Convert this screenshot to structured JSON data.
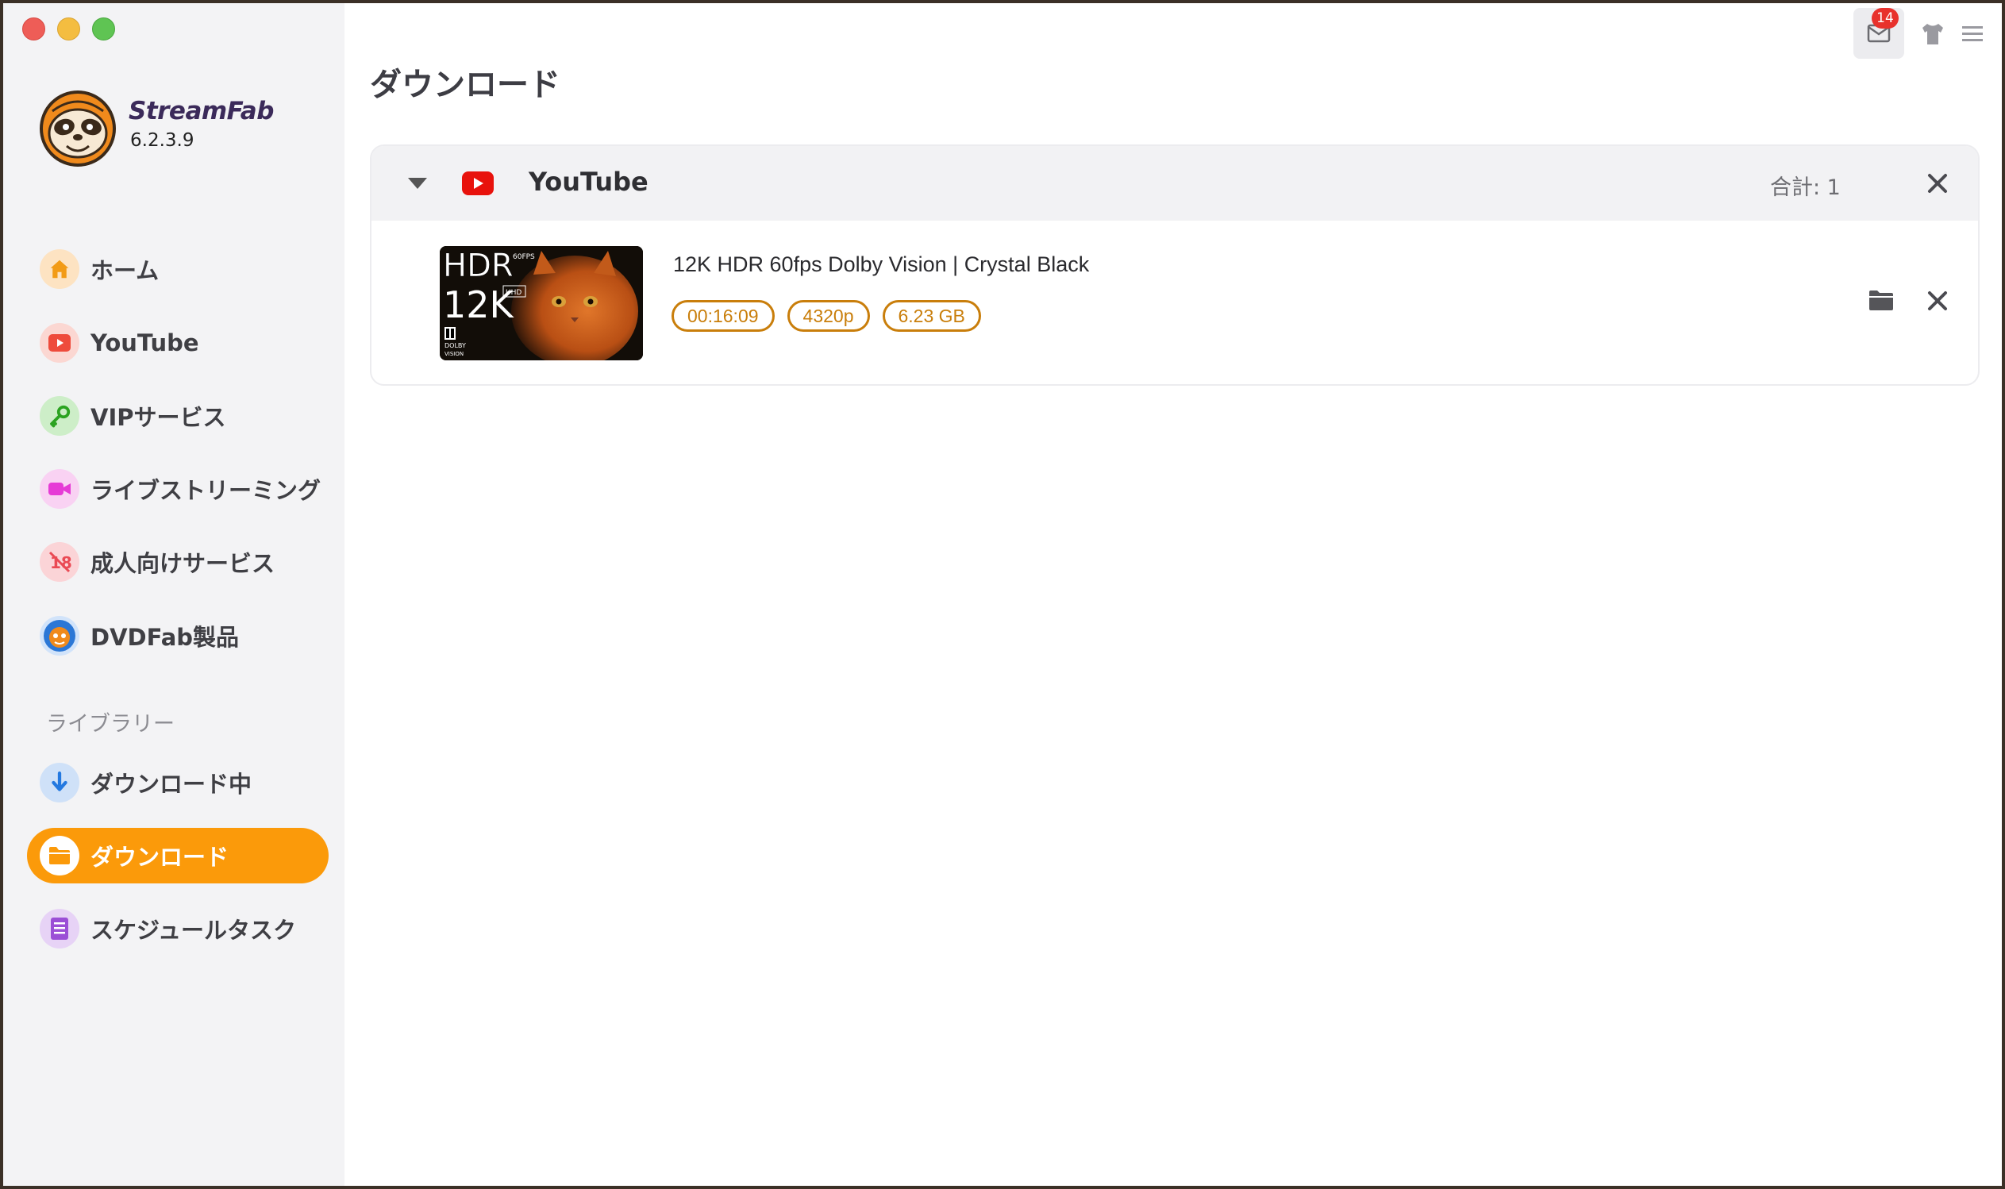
{
  "app": {
    "name": "StreamFab",
    "version": "6.2.3.9"
  },
  "sidebar": {
    "items": [
      {
        "label": "ホーム",
        "icon": "home-icon",
        "color": "#f29b16",
        "bg": "#fde3c2"
      },
      {
        "label": "YouTube",
        "icon": "youtube-icon",
        "color": "#ee4b3c",
        "bg": "#fbd7d2"
      },
      {
        "label": "VIPサービス",
        "icon": "key-icon",
        "color": "#2ba321",
        "bg": "#cdeec8"
      },
      {
        "label": "ライブストリーミング",
        "icon": "video-camera-icon",
        "color": "#e63bd6",
        "bg": "#f9d2f3"
      },
      {
        "label": "成人向けサービス",
        "icon": "adult-18-icon",
        "color": "#ea4a54",
        "bg": "#fbd4d7"
      },
      {
        "label": "DVDFab製品",
        "icon": "dvdfab-icon",
        "color": "#2b77d6",
        "bg": "#d1e3fa"
      }
    ],
    "library_label": "ライブラリー",
    "library_items": [
      {
        "label": "ダウンロード中",
        "icon": "download-arrow-icon",
        "color": "#2479e0",
        "bg": "#cfe1f8"
      },
      {
        "label": "ダウンロード",
        "icon": "folder-icon",
        "color": "#fb9a0a",
        "bg": "#ffffff",
        "active": true
      },
      {
        "label": "スケジュールタスク",
        "icon": "schedule-list-icon",
        "color": "#9b4fd6",
        "bg": "#e7d3f6"
      }
    ]
  },
  "topbar": {
    "mail_badge": "14"
  },
  "main": {
    "title": "ダウンロード",
    "group": {
      "name": "YouTube",
      "total": "合計: 1",
      "items": [
        {
          "title": "12K HDR 60fps Dolby Vision | Crystal Black",
          "duration": "00:16:09",
          "resolution": "4320p",
          "size": "6.23 GB",
          "thumb_text": {
            "hdr": "HDR",
            "res": "12K",
            "fps": "60FPS",
            "uhd": "UHD",
            "dolby": "DOLBY",
            "vision": "VISION"
          }
        }
      ]
    }
  },
  "colors": {
    "accent": "#fb9a0a",
    "tag": "#c97e0b",
    "badge": "#e8312c"
  }
}
